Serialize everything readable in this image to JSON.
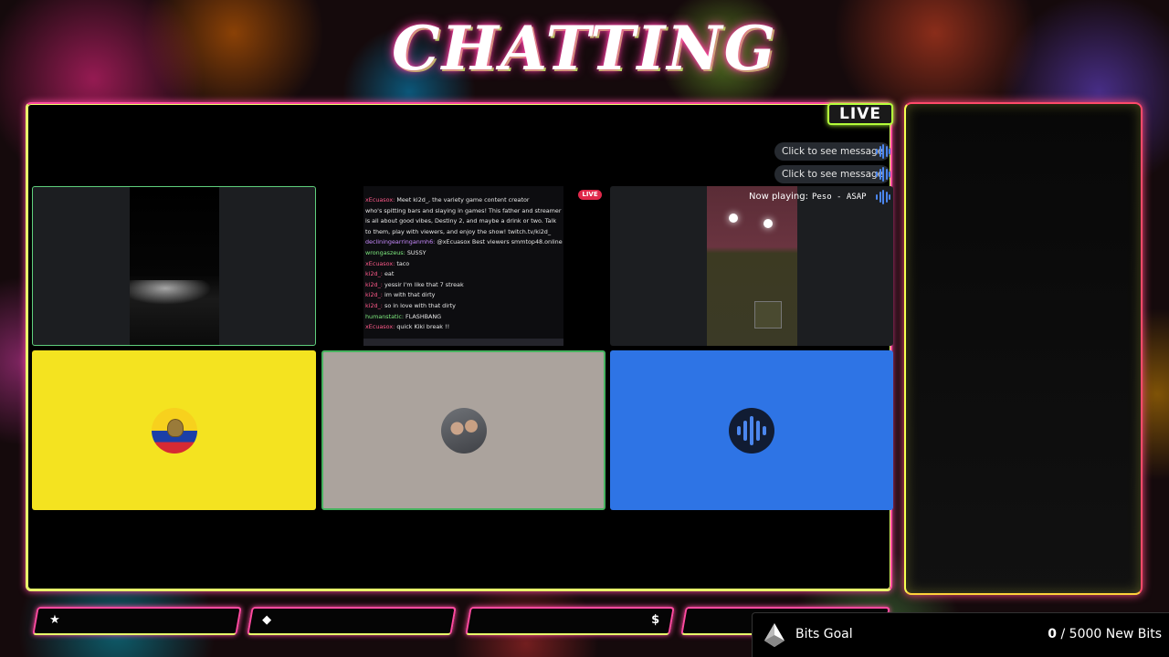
{
  "title": "CHATTING",
  "live_badge": "LIVE",
  "toasts": [
    {
      "label": "Click to see message",
      "icon": "audio-wave-icon"
    },
    {
      "label": "Click to see message",
      "icon": "audio-wave-icon"
    }
  ],
  "now_playing": {
    "label": "Now playing:",
    "song": "Peso - ASAP",
    "icon": "audio-wave-icon"
  },
  "stream_tile": {
    "live_label": "LIVE",
    "chat_lines": [
      {
        "user": "xEcuasox:",
        "text": " Meet ki2d_, the variety game content creator"
      },
      {
        "user": "",
        "text": "who's spitting bars and slaying in games! This father and streamer"
      },
      {
        "user": "",
        "text": "is all about good vibes, Destiny 2, and maybe a drink or two. Talk"
      },
      {
        "user": "",
        "text": "to them, play with viewers, and enjoy the show! twitch.tv/ki2d_"
      },
      {
        "user": "decliningearringanmh6:",
        "text": " @xEcuasox Best viewers smmtop48.online"
      },
      {
        "user": "wrongaszeus:",
        "text": " SUSSY"
      },
      {
        "user": "xEcuasox:",
        "text": " taco"
      },
      {
        "user": "ki2d_:",
        "text": " eat"
      },
      {
        "user": "ki2d_:",
        "text": " yessir I'm like that 7 streak"
      },
      {
        "user": "ki2d_:",
        "text": " im with that dirty"
      },
      {
        "user": "ki2d_:",
        "text": " so in love with that dirty"
      },
      {
        "user": "humanstatic:",
        "text": " FLASHBANG"
      },
      {
        "user": "xEcuasox:",
        "text": " quick Kiki break !!"
      }
    ]
  },
  "tiles": [
    {
      "name": "participant-camera-1",
      "kind": "video"
    },
    {
      "name": "participant-screen-share",
      "kind": "screen"
    },
    {
      "name": "participant-camera-2",
      "kind": "video"
    },
    {
      "name": "participant-avatar-flag",
      "kind": "avatar",
      "bg": "#f4e320"
    },
    {
      "name": "participant-avatar-photo",
      "kind": "avatar",
      "bg": "#aba39d"
    },
    {
      "name": "participant-avatar-audio",
      "kind": "avatar",
      "bg": "#2e74e5"
    }
  ],
  "bottom_bars": [
    {
      "icon": "star-icon",
      "glyph": "★"
    },
    {
      "icon": "diamond-icon",
      "glyph": "◆"
    },
    {
      "icon": "dollar-icon",
      "glyph": "$"
    },
    {
      "icon": "",
      "glyph": ""
    }
  ],
  "bits_goal": {
    "label": "Bits Goal",
    "current": "0",
    "separator": " / ",
    "goal": "5000 New Bits"
  },
  "colors": {
    "accent_pink": "#ff4aa0",
    "accent_lime": "#e9ff6a",
    "live_green": "#b4ff3a",
    "tile_blue": "#2e74e5",
    "tile_yellow": "#f4e320"
  }
}
